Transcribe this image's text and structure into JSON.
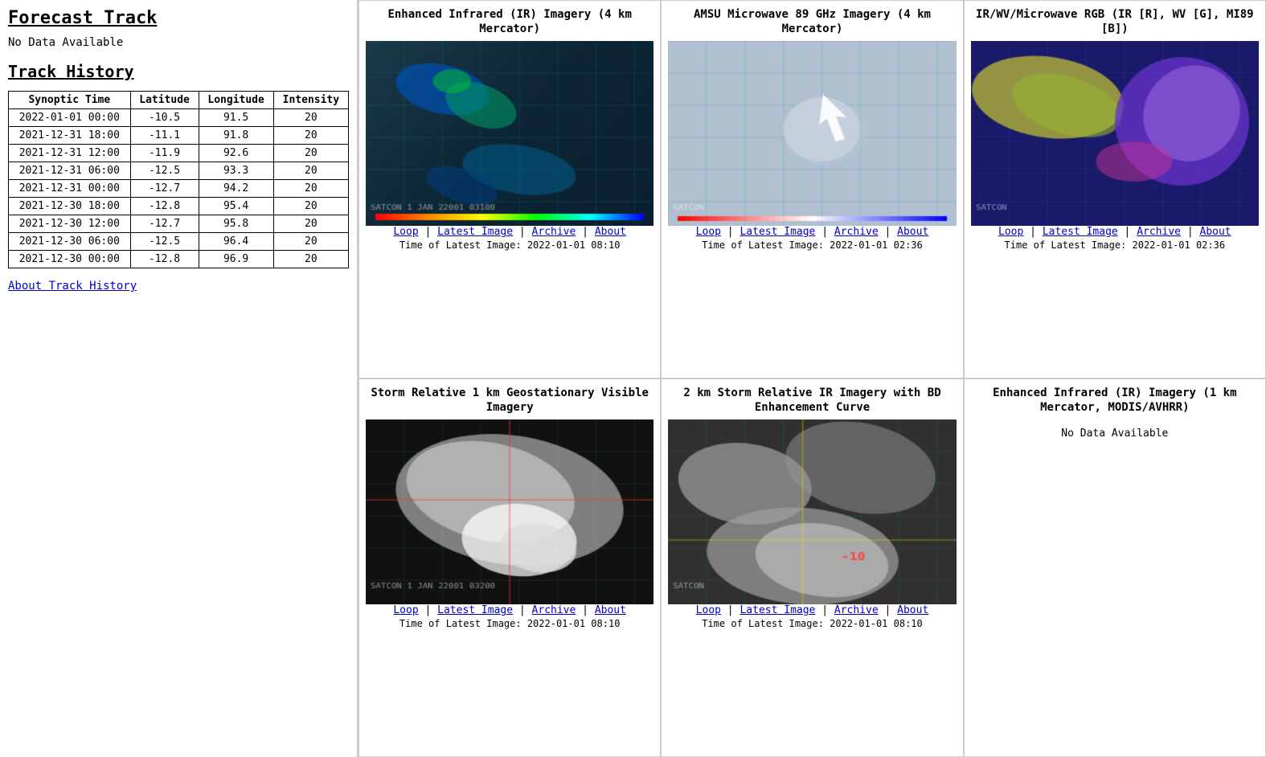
{
  "leftPanel": {
    "forecastTitle": "Forecast Track",
    "noData": "No Data Available",
    "trackHistoryTitle": "Track History",
    "tableHeaders": [
      "Synoptic Time",
      "Latitude",
      "Longitude",
      "Intensity"
    ],
    "tableRows": [
      {
        "time": "2022-01-01 00:00",
        "lat": "-10.5",
        "lon": "91.5",
        "intensity": "20"
      },
      {
        "time": "2021-12-31 18:00",
        "lat": "-11.1",
        "lon": "91.8",
        "intensity": "20"
      },
      {
        "time": "2021-12-31 12:00",
        "lat": "-11.9",
        "lon": "92.6",
        "intensity": "20"
      },
      {
        "time": "2021-12-31 06:00",
        "lat": "-12.5",
        "lon": "93.3",
        "intensity": "20"
      },
      {
        "time": "2021-12-31 00:00",
        "lat": "-12.7",
        "lon": "94.2",
        "intensity": "20"
      },
      {
        "time": "2021-12-30 18:00",
        "lat": "-12.8",
        "lon": "95.4",
        "intensity": "20"
      },
      {
        "time": "2021-12-30 12:00",
        "lat": "-12.7",
        "lon": "95.8",
        "intensity": "20"
      },
      {
        "time": "2021-12-30 06:00",
        "lat": "-12.5",
        "lon": "96.4",
        "intensity": "20"
      },
      {
        "time": "2021-12-30 00:00",
        "lat": "-12.8",
        "lon": "96.9",
        "intensity": "20"
      }
    ],
    "aboutLink": "About Track History"
  },
  "imagery": [
    {
      "id": "ir-4km",
      "title": "Enhanced Infrared (IR) Imagery (4 km Mercator)",
      "imgType": "ir-enhanced",
      "links": [
        "Loop",
        "Latest Image",
        "Archive",
        "About"
      ],
      "timeLabel": "Time of Latest Image: 2022-01-01 08:10"
    },
    {
      "id": "amsu-89ghz",
      "title": "AMSU Microwave 89 GHz Imagery (4 km Mercator)",
      "imgType": "microwave",
      "links": [
        "Loop",
        "Latest Image",
        "Archive",
        "About"
      ],
      "timeLabel": "Time of Latest Image: 2022-01-01 02:36"
    },
    {
      "id": "ir-wv-rgb",
      "title": "IR/WV/Microwave RGB (IR [R], WV [G], MI89 [B])",
      "imgType": "rgb",
      "links": [
        "Loop",
        "Latest Image",
        "Archive",
        "About"
      ],
      "timeLabel": "Time of Latest Image: 2022-01-01 02:36"
    },
    {
      "id": "vis-1km",
      "title": "Storm Relative 1 km Geostationary Visible Imagery",
      "imgType": "visible",
      "links": [
        "Loop",
        "Latest Image",
        "Archive",
        "About"
      ],
      "timeLabel": "Time of Latest Image: 2022-01-01 08:10"
    },
    {
      "id": "bd-2km",
      "title": "2 km Storm Relative IR Imagery with BD Enhancement Curve",
      "imgType": "bd-ir",
      "links": [
        "Loop",
        "Latest Image",
        "Archive",
        "About"
      ],
      "timeLabel": "Time of Latest Image: 2022-01-01 08:10"
    },
    {
      "id": "modis-1km",
      "title": "Enhanced Infrared (IR) Imagery (1 km Mercator, MODIS/AVHRR)",
      "imgType": "none",
      "noData": "No Data Available",
      "links": [],
      "timeLabel": ""
    }
  ]
}
